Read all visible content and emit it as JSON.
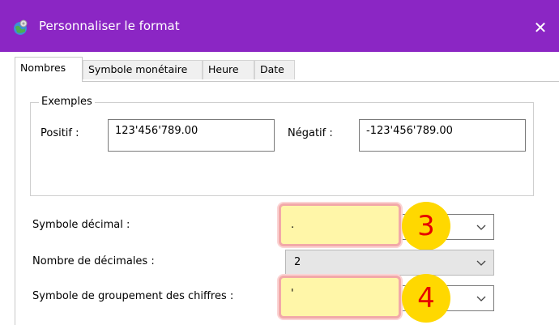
{
  "window": {
    "title": "Personnaliser le format",
    "close_label": "✕"
  },
  "tabs": [
    {
      "label": "Nombres",
      "active": true
    },
    {
      "label": "Symbole monétaire",
      "active": false
    },
    {
      "label": "Heure",
      "active": false
    },
    {
      "label": "Date",
      "active": false
    }
  ],
  "examples": {
    "legend": "Exemples",
    "positive_label": "Positif :",
    "positive_value": "123'456'789.00",
    "negative_label": "Négatif :",
    "negative_value": "-123'456'789.00"
  },
  "settings": {
    "decimal_symbol_label": "Symbole décimal :",
    "decimal_symbol_value": ".",
    "decimal_places_label": "Nombre de décimales :",
    "decimal_places_value": "2",
    "grouping_symbol_label": "Symbole de groupement des chiffres :",
    "grouping_symbol_value": "'"
  },
  "annotations": {
    "badge_3": "3",
    "badge_4": "4"
  },
  "colors": {
    "titlebar": "#8b26c4",
    "highlight_fill": "#fff6a8",
    "highlight_border": "#f2a9a9",
    "badge_fill": "#ffd800",
    "badge_text": "#e60000"
  }
}
